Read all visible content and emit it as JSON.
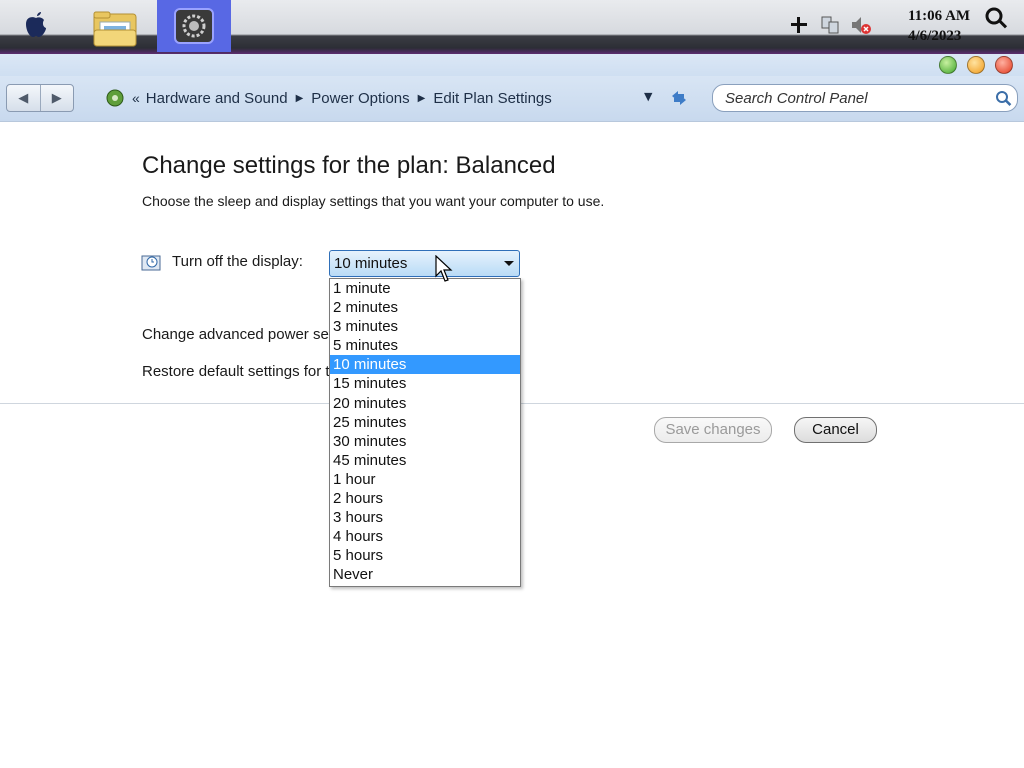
{
  "taskbar": {
    "time": "11:06 AM",
    "date": "4/6/2023"
  },
  "address_bar": {
    "crumbs": [
      "Hardware and Sound",
      "Power Options",
      "Edit Plan Settings"
    ],
    "search_placeholder": "Search Control Panel"
  },
  "content": {
    "heading": "Change settings for the plan: Balanced",
    "subheading": "Choose the sleep and display settings that you want your computer to use.",
    "display_label": "Turn off the display:",
    "display_value": "10 minutes",
    "link_advanced": "Change advanced power settings",
    "link_restore": "Restore default settings for this plan"
  },
  "dropdown": {
    "selected_index": 4,
    "options": [
      "1 minute",
      "2 minutes",
      "3 minutes",
      "5 minutes",
      "10 minutes",
      "15 minutes",
      "20 minutes",
      "25 minutes",
      "30 minutes",
      "45 minutes",
      "1 hour",
      "2 hours",
      "3 hours",
      "4 hours",
      "5 hours",
      "Never"
    ]
  },
  "buttons": {
    "save": "Save changes",
    "cancel": "Cancel"
  },
  "colors": {
    "accent": "#3399ff",
    "active_dock": "#5868e4"
  },
  "icons": [
    "apple-icon",
    "folder-icon",
    "settings-icon",
    "plus-icon",
    "network-icon",
    "volume-muted-icon",
    "search-icon",
    "control-panel-icon",
    "refresh-icon",
    "display-clock-icon"
  ]
}
